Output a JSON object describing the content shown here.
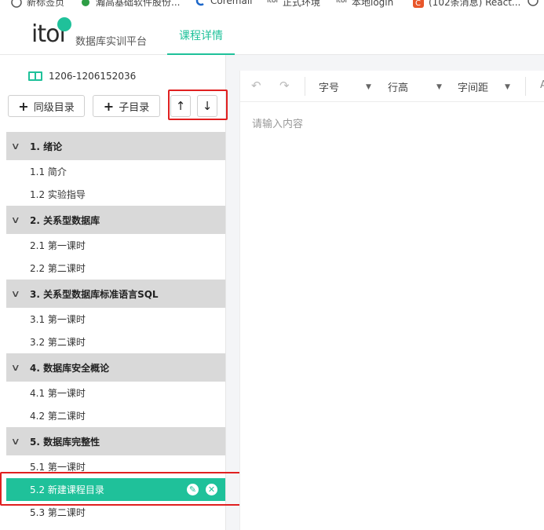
{
  "bookmarks": [
    {
      "label": "新标签页",
      "icon": "globe-icon"
    },
    {
      "label": "瀚高基础软件股份...",
      "icon": "gear-icon"
    },
    {
      "label": "Coremail",
      "icon": "coremail-icon"
    },
    {
      "label": "正式环境",
      "icon": "itol-icon"
    },
    {
      "label": "本地login",
      "icon": "itol-icon"
    },
    {
      "label": "(102条消息) React...",
      "icon": "csdn-icon"
    }
  ],
  "header": {
    "logo_text": "itol",
    "platform_name": "数据库实训平台",
    "tab_course_detail": "课程详情"
  },
  "sidebar": {
    "course_id": "1206-1206152036",
    "btn_sibling": "同级目录",
    "btn_child": "子目录",
    "move_up": "↑",
    "move_down": "↓",
    "chapters": [
      {
        "title": "1. 绪论",
        "items": [
          "1.1 简介",
          "1.2 实验指导"
        ]
      },
      {
        "title": "2. 关系型数据库",
        "items": [
          "2.1 第一课时",
          "2.2 第二课时"
        ]
      },
      {
        "title": "3. 关系型数据库标准语言SQL",
        "items": [
          "3.1 第一课时",
          "3.2 第二课时"
        ]
      },
      {
        "title": "4. 数据库安全概论",
        "items": [
          "4.1 第一课时",
          "4.2 第二课时"
        ]
      },
      {
        "title": "5. 数据库完整性",
        "items": [
          "5.1 第一课时",
          "5.2 新建课程目录",
          "5.3 第二课时"
        ]
      }
    ],
    "active_item": "5.2 新建课程目录"
  },
  "editor": {
    "toolbar": {
      "font_size": "字号",
      "line_height": "行高",
      "letter_spacing": "字间距"
    },
    "placeholder": "请输入内容"
  },
  "colors": {
    "accent": "#1fc19a",
    "chapter_bg": "#d9d9d9",
    "highlight_box": "#e02020"
  }
}
